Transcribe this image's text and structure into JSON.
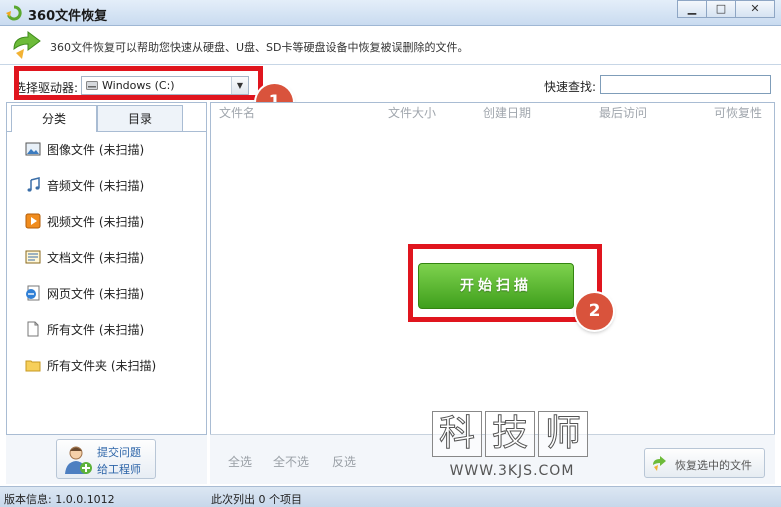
{
  "window": {
    "title": "360文件恢复"
  },
  "info": {
    "text": "360文件恢复可以帮助您快速从硬盘、U盘、SD卡等硬盘设备中恢复被误删除的文件。"
  },
  "toolbar": {
    "drive_label": "选择驱动器:",
    "drive_value": "Windows (C:)",
    "search_label": "快速查找:",
    "search_value": ""
  },
  "tabs": [
    {
      "label": "分类"
    },
    {
      "label": "目录"
    }
  ],
  "categories": [
    {
      "label": "图像文件 (未扫描)",
      "icon": "image-icon"
    },
    {
      "label": "音频文件 (未扫描)",
      "icon": "music-icon"
    },
    {
      "label": "视频文件 (未扫描)",
      "icon": "video-icon"
    },
    {
      "label": "文档文件 (未扫描)",
      "icon": "document-icon"
    },
    {
      "label": "网页文件 (未扫描)",
      "icon": "webpage-icon"
    },
    {
      "label": "所有文件 (未扫描)",
      "icon": "file-icon"
    },
    {
      "label": "所有文件夹 (未扫描)",
      "icon": "folder-icon"
    }
  ],
  "columns": [
    "文件名",
    "文件大小",
    "创建日期",
    "最后访问",
    "可恢复性"
  ],
  "main": {
    "start_label": "开始扫描"
  },
  "help": {
    "line1": "提交问题",
    "line2": "给工程师"
  },
  "selection": {
    "all": "全选",
    "none": "全不选",
    "invert": "反选"
  },
  "restore": {
    "label": "恢复选中的文件"
  },
  "status": {
    "version": "版本信息: 1.0.0.1012",
    "count": "此次列出 0 个项目"
  },
  "annotations": {
    "badge1": "1",
    "badge2": "2",
    "highlight_color": "#e0151e"
  },
  "watermark": {
    "chars": [
      "科",
      "技",
      "师"
    ],
    "url": "WWW.3KJS.COM"
  },
  "colors": {
    "accent_green": "#4aa624",
    "title_bg": "#c9dbf0"
  }
}
